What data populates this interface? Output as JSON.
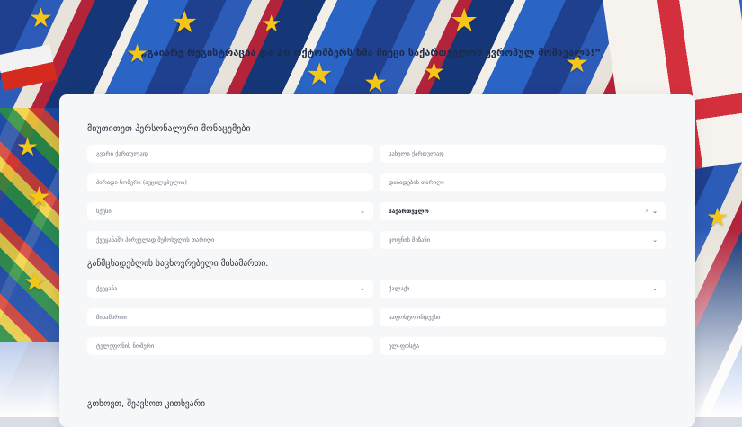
{
  "header": {
    "headline": "„გაიარე რეგისტრაცია და 26 ოქტომბერს ხმა მიეცი საქართველოს ევროპულ მომავალს!“"
  },
  "form": {
    "personal_section_title": "მიუთითეთ პერსონალური მონაცემები",
    "surname": {
      "placeholder": "გვარი ქართულად"
    },
    "name": {
      "placeholder": "სახელი ქართულად"
    },
    "personal_id": {
      "placeholder": "პირადი ნომერი (აუცილებელია)"
    },
    "birth_date": {
      "placeholder": "დაბადების თარიღი"
    },
    "gender": {
      "placeholder": "სქესი"
    },
    "citizenship": {
      "value": "საქართველო"
    },
    "foreign_country": {
      "placeholder": "ქვეყანაში პირველად შემოსვლის თარიღი"
    },
    "stay_status": {
      "placeholder": "ყოფნის მიზანი"
    },
    "address_section_title": "განმცხადებლის საცხოვრებელი მისამართი.",
    "country": {
      "placeholder": "ქვეყანა"
    },
    "city": {
      "placeholder": "ქალაქი"
    },
    "address": {
      "placeholder": "მისამართი"
    },
    "postal_code": {
      "placeholder": "საფოსტო ინდექსი"
    },
    "phone": {
      "placeholder": "ტელეფონის ნომერი"
    },
    "email": {
      "placeholder": "ელ-ფოსტა"
    },
    "survey_section_title": "გთხოვთ, შეავსოთ კითხვარი"
  },
  "icons": {
    "chevron": "chevron-down-icon",
    "clear": "clear-icon"
  },
  "colors": {
    "card_bg": "#f6f7f9",
    "field_bg": "#ffffff",
    "star": "#f5c518",
    "flag_red": "#d32f3c",
    "eu_blue": "#1f3f8f"
  }
}
